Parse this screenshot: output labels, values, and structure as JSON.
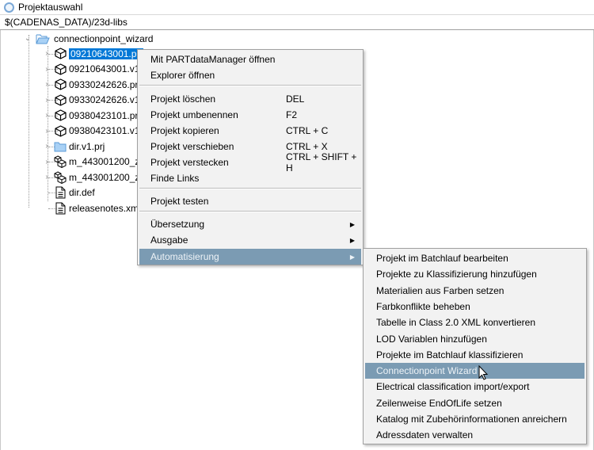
{
  "window": {
    "title": "Projektauswahl"
  },
  "path": "$(CADENAS_DATA)/23d-libs",
  "tree": {
    "root": {
      "label": "connectionpoint_wizard",
      "icon": "folder-open-icon"
    },
    "children": [
      {
        "label": "09210643001.prj",
        "icon": "cube-icon",
        "selected": true
      },
      {
        "label": "09210643001.v1.p",
        "icon": "cube-icon"
      },
      {
        "label": "09330242626.prj",
        "icon": "cube-icon"
      },
      {
        "label": "09330242626.v1.p",
        "icon": "cube-icon"
      },
      {
        "label": "09380423101.prj",
        "icon": "cube-icon"
      },
      {
        "label": "09380423101.v1.p",
        "icon": "cube-icon"
      },
      {
        "label": "dir.v1.prj",
        "icon": "folder-icon"
      },
      {
        "label": "m_443001200_zul",
        "icon": "assembly-icon"
      },
      {
        "label": "m_443001200_zul",
        "icon": "assembly-icon"
      },
      {
        "label": "dir.def",
        "icon": "file-icon"
      },
      {
        "label": "releasenotes.xml",
        "icon": "file-icon"
      }
    ]
  },
  "context_menu": {
    "items": [
      {
        "label": "Mit PARTdataManager öffnen"
      },
      {
        "label": "Explorer öffnen"
      },
      {
        "label": "Projekt löschen",
        "shortcut": "DEL"
      },
      {
        "label": "Projekt umbenennen",
        "shortcut": "F2"
      },
      {
        "label": "Projekt kopieren",
        "shortcut": "CTRL + C"
      },
      {
        "label": "Projekt verschieben",
        "shortcut": "CTRL + X"
      },
      {
        "label": "Projekt verstecken",
        "shortcut": "CTRL + SHIFT + H"
      },
      {
        "label": "Finde Links"
      },
      {
        "label": "Projekt testen"
      },
      {
        "label": "Übersetzung"
      },
      {
        "label": "Ausgabe"
      },
      {
        "label": "Automatisierung"
      }
    ]
  },
  "submenu": {
    "items": [
      "Projekt im Batchlauf bearbeiten",
      "Projekte zu Klassifizierung hinzufügen",
      "Materialien aus Farben setzen",
      "Farbkonflikte beheben",
      "Tabelle in Class 2.0 XML konvertieren",
      "LOD Variablen hinzufügen",
      "Projekte im Batchlauf klassifizieren",
      "Connectionpoint Wizard",
      "Electrical classification import/export",
      "Zeilenweise EndOfLife setzen",
      "Katalog mit Zubehörinformationen anreichern",
      "Adressdaten verwalten"
    ]
  },
  "colors": {
    "highlight": "#7b9bb3",
    "selection": "#0078d7"
  }
}
